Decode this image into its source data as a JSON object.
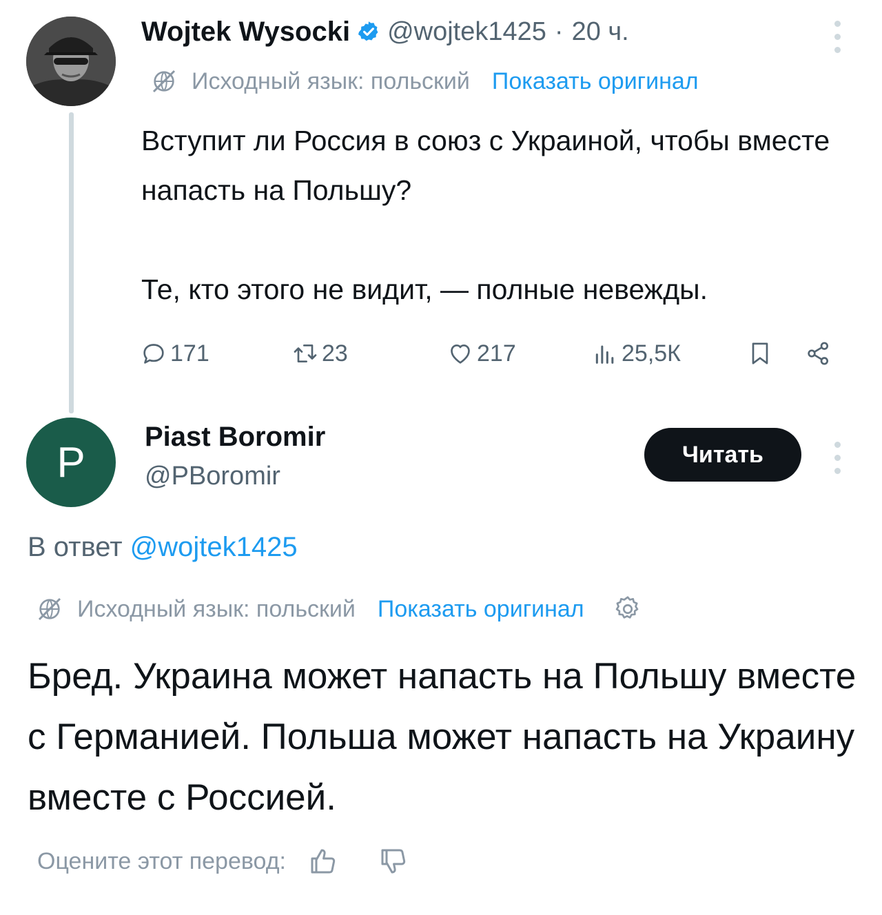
{
  "tweet": {
    "author_name": "Wojtek Wysocki",
    "handle": "@wojtek1425",
    "separator": "·",
    "time": "20 ч.",
    "translation": {
      "source_language": "Исходный язык: польский",
      "show_original": "Показать оригинал"
    },
    "text": "Вступит ли Россия в союз с Украиной, чтобы вместе напасть на Польшу?\n\nТе, кто этого не видит, — полные невежды.",
    "actions": {
      "replies": "171",
      "reposts": "23",
      "likes": "217",
      "views": "25,5К"
    }
  },
  "reply": {
    "avatar_letter": "P",
    "author_name": "Piast Boromir",
    "handle": "@PBoromir",
    "follow_label": "Читать",
    "replying_prefix": "В ответ",
    "replying_to": "@wojtek1425",
    "translation": {
      "source_language": "Исходный язык: польский",
      "show_original": "Показать оригинал"
    },
    "text": "Бред. Украина может напасть на Польшу вместе с Германией. Польша может напасть на Украину вместе с Россией.",
    "rate_translation": "Оцените этот перевод:"
  },
  "colors": {
    "text_primary": "#0f1419",
    "text_secondary": "#536471",
    "link": "#1d9bf0",
    "verified": "#1d9bf0",
    "button_bg": "#0f1419",
    "reply_avatar_bg": "#1a5c4a",
    "thread_line": "#cfd9de"
  },
  "icons": [
    "verified-badge-icon",
    "more-icon",
    "translate-globe-icon",
    "reply-icon",
    "repost-icon",
    "like-icon",
    "views-icon",
    "bookmark-icon",
    "share-icon",
    "settings-gear-icon",
    "thumbs-up-icon",
    "thumbs-down-icon"
  ]
}
